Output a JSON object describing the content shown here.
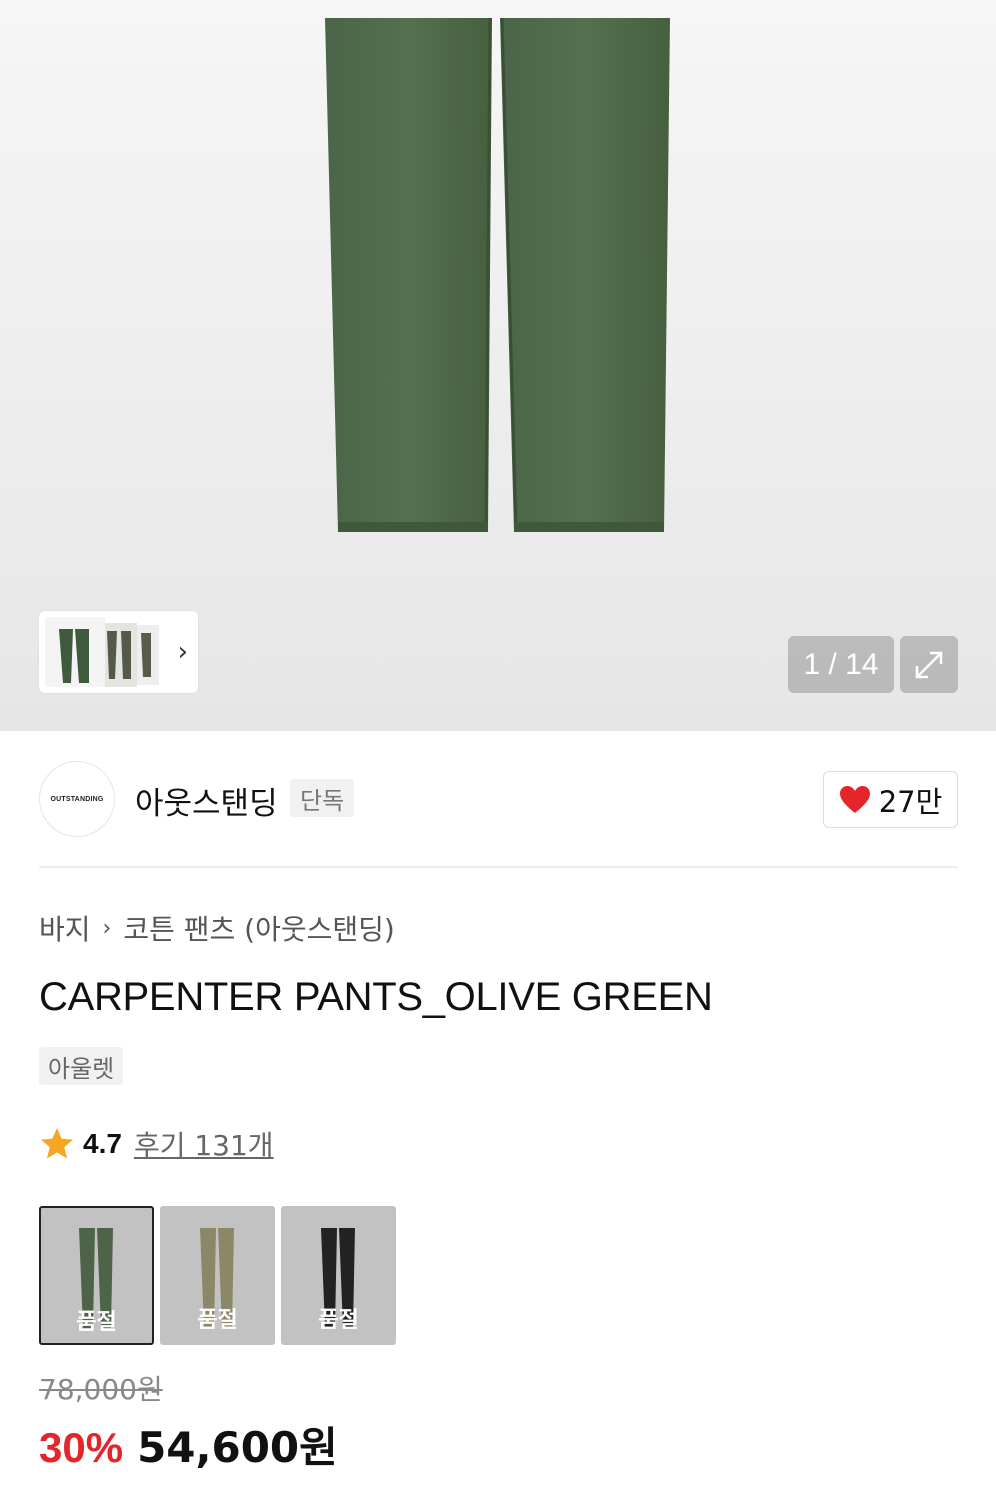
{
  "gallery": {
    "counter": "1 / 14",
    "icons": {
      "expand": "expand-icon",
      "next": "chevron-right-icon"
    },
    "pants_color": "#4f6b4b"
  },
  "brand": {
    "logo_text": "OUTSTANDING",
    "name": "아웃스탠딩",
    "badge": "단독",
    "likes": "27만",
    "icons": {
      "like": "heart-icon"
    },
    "heart_color": "#e5252a"
  },
  "breadcrumb": {
    "category": "바지",
    "subcategory": "코튼 팬츠 (아웃스탠딩)"
  },
  "product": {
    "title": "CARPENTER PANTS_OLIVE GREEN",
    "tag": "아울렛",
    "rating": "4.7",
    "reviews": "후기 131개"
  },
  "color_options": [
    {
      "label": "품절",
      "color": "#4d6448",
      "selected": true
    },
    {
      "label": "품절",
      "color": "#8c8767",
      "selected": false
    },
    {
      "label": "품절",
      "color": "#222222",
      "selected": false
    }
  ],
  "price": {
    "original": "78,000원",
    "discount": "30%",
    "final": "54,600원"
  },
  "colors": {
    "accent": "#e5252a",
    "star": "#f5a623"
  }
}
